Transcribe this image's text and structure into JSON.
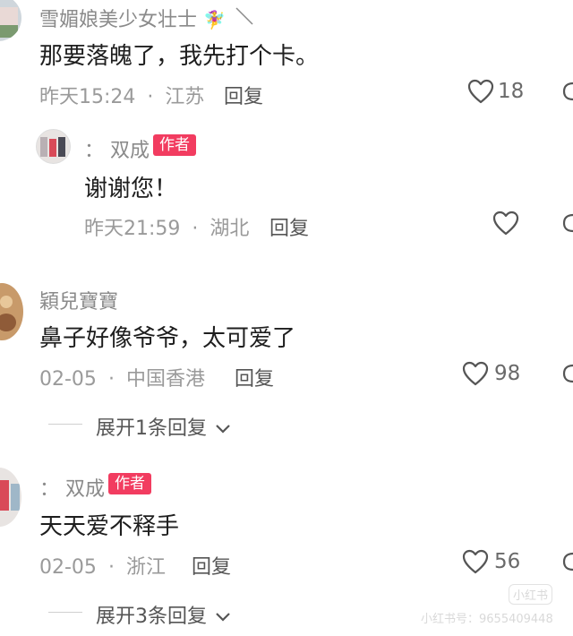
{
  "comments": [
    {
      "name": "雪媚娘美少女壮士",
      "name_emoji": "🧚‍♀️",
      "text": "那要落魄了，我先打个卡。",
      "time": "昨天15:24",
      "location": "江苏",
      "reply_label": "回复",
      "likes": "18"
    },
    {
      "name_prefix": "：",
      "name": "双成",
      "badge": "作者",
      "text": "谢谢您！",
      "time": "昨天21:59",
      "location": "湖北",
      "reply_label": "回复"
    },
    {
      "name": "穎兒寶寶",
      "text": "鼻子好像爷爷，太可爱了",
      "time": "02-05",
      "location": "中国香港",
      "reply_label": "回复",
      "likes": "98",
      "expand": "展开1条回复"
    },
    {
      "name_prefix": "：",
      "name": "双成",
      "badge": "作者",
      "text": "天天爱不释手",
      "time": "02-05",
      "location": "浙江",
      "reply_label": "回复",
      "likes": "56",
      "expand": "展开3条回复"
    }
  ],
  "separator": "·",
  "watermark": {
    "logo": "小红书",
    "id_line": "小红书号：9655409448"
  },
  "colors": {
    "badge": "#f23c60",
    "meta_text": "#9a9a9a"
  }
}
